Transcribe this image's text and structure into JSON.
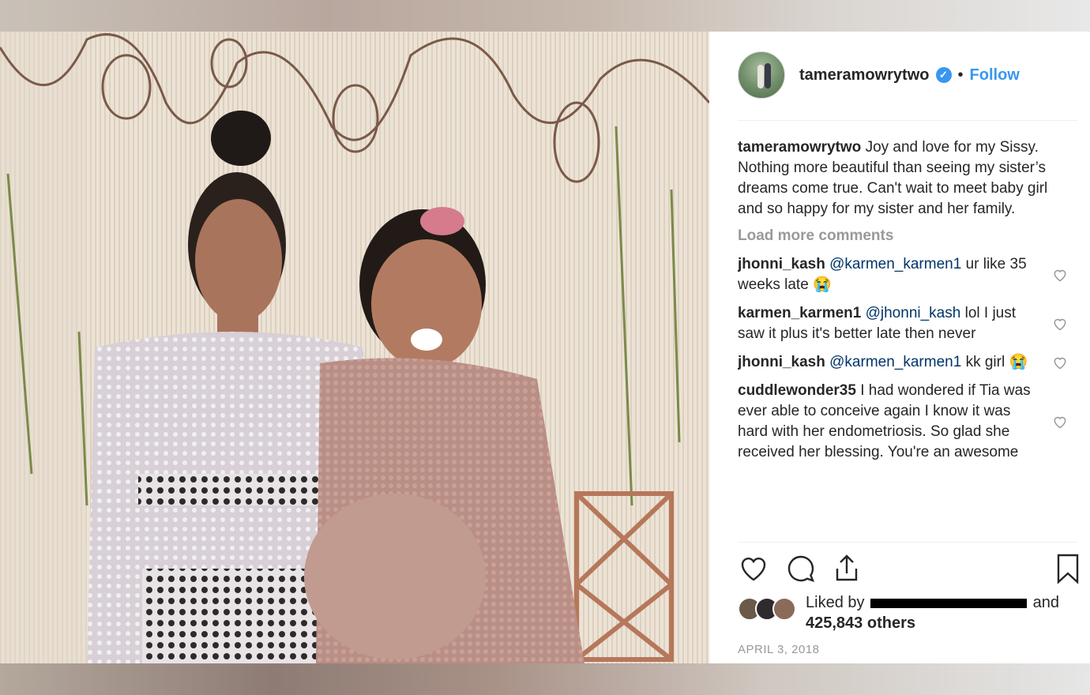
{
  "post": {
    "username": "tameramowrytwo",
    "verified_icon": "verified-badge-icon",
    "separator": "•",
    "follow_label": "Follow"
  },
  "caption": {
    "username": "tameramowrytwo",
    "text": "Joy and love for my Sissy. Nothing more beautiful than seeing my sister’s dreams come true. Can't wait to meet baby girl and so happy for my sister and her family."
  },
  "load_more_label": "Load more comments",
  "comments": [
    {
      "username": "jhonni_kash",
      "mention": "@karmen_karmen1",
      "text": "ur like 35 weeks late 😭"
    },
    {
      "username": "karmen_karmen1",
      "mention": "@jhonni_kash",
      "text": "lol I just saw it plus it's better late then never"
    },
    {
      "username": "jhonni_kash",
      "mention": "@karmen_karmen1",
      "text": "kk girl 😭"
    },
    {
      "username": "cuddlewonder35",
      "mention": "",
      "text": "I had wondered if Tia was ever able to conceive again I know it was hard with her endometriosis. So glad she received her blessing. You're an awesome"
    }
  ],
  "likes": {
    "prefix": "Liked by",
    "suffix": "and",
    "count": "425,843 others"
  },
  "date": "APRIL 3, 2018",
  "colors": {
    "accent": "#3897f0",
    "text": "#262626",
    "muted": "#999999"
  }
}
